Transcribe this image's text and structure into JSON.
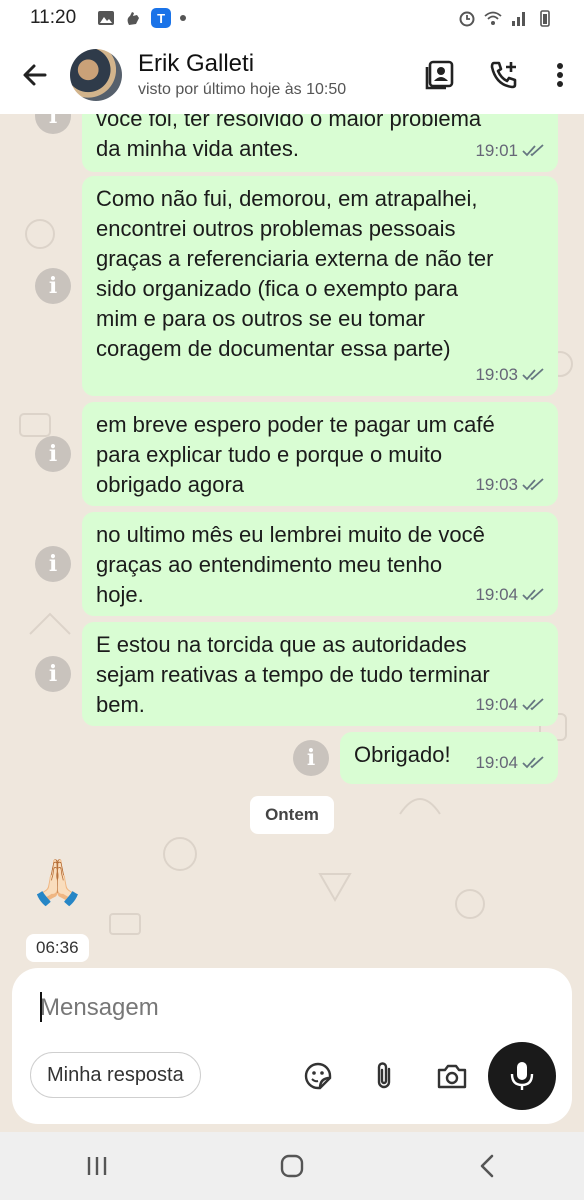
{
  "status_bar": {
    "time": "11:20",
    "app_badge": "T"
  },
  "header": {
    "contact_name": "Erik Galleti",
    "last_seen": "visto por último hoje às 10:50"
  },
  "messages": [
    {
      "lines": [
        "você foi, ter resolvido o maior problema",
        "da minha  vida antes."
      ],
      "time": "19:01"
    },
    {
      "lines": [
        "Como não fui, demorou, em atrapalhei,",
        "encontrei outros problemas pessoais",
        "graças a referenciaria externa de não ter",
        "sido organizado (fica o exempto para",
        "mim e para os outros se eu tomar",
        "coragem de documentar essa parte)"
      ],
      "time": "19:03"
    },
    {
      "lines": [
        "em breve espero poder te pagar um café",
        "para explicar tudo e porque o muito",
        "obrigado agora"
      ],
      "time": "19:03"
    },
    {
      "lines": [
        "no ultimo mês eu lembrei muito de você",
        "graças ao entendimento meu tenho",
        "hoje."
      ],
      "time": "19:04"
    },
    {
      "lines": [
        "E estou na torcida que as autoridades",
        "sejam reativas a tempo de tudo terminar",
        "bem."
      ],
      "time": "19:04"
    },
    {
      "lines": [
        "Obrigado!"
      ],
      "time": "19:04"
    }
  ],
  "date_separator": "Ontem",
  "incoming": {
    "emoji": "🙏🏻",
    "time": "06:36"
  },
  "compose": {
    "placeholder": "Mensagem",
    "quick_reply": "Minha resposta"
  },
  "colors": {
    "outgoing_bubble": "#d9fdd3",
    "chat_background": "#efe7dd",
    "read_ticks": "#667781"
  }
}
